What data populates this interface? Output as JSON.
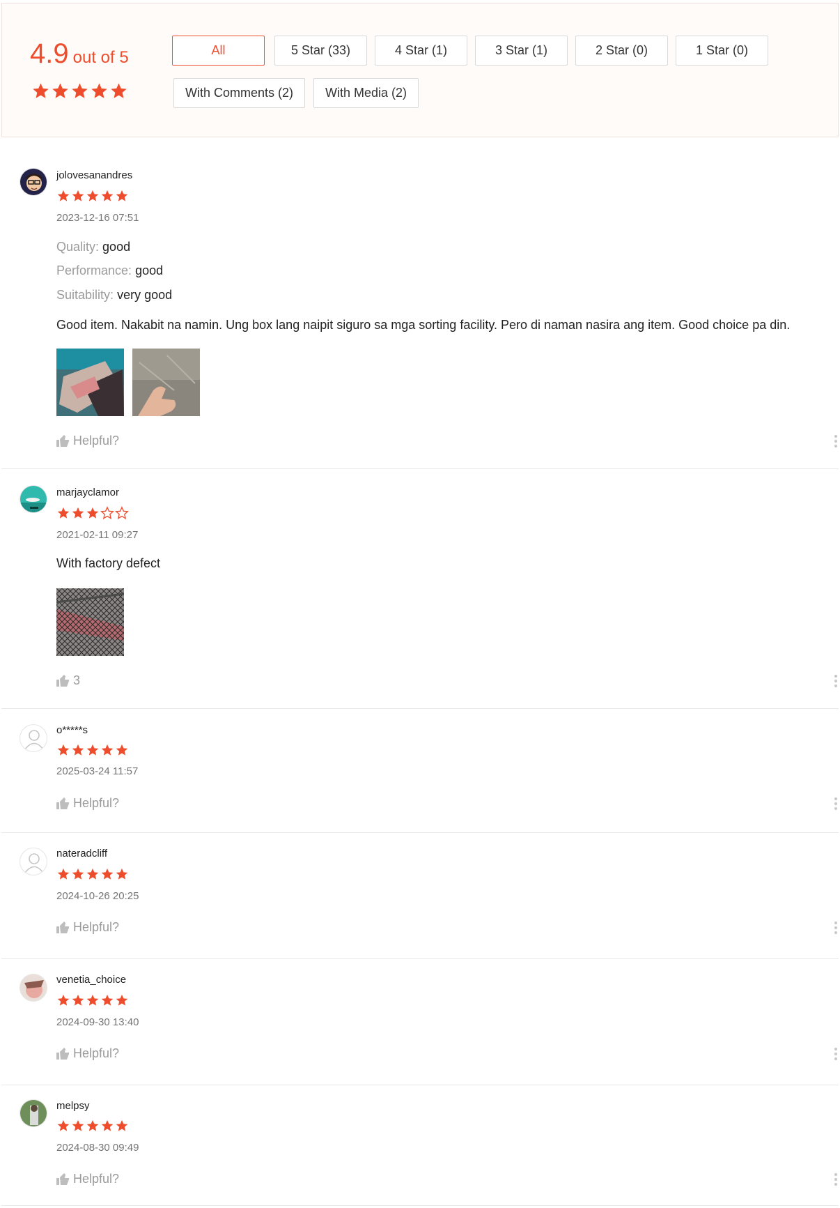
{
  "summary": {
    "score": "4.9",
    "out_of": "out of 5",
    "stars": 5,
    "filters": [
      {
        "label": "All",
        "active": true
      },
      {
        "label": "5 Star (33)"
      },
      {
        "label": "4 Star (1)"
      },
      {
        "label": "3 Star (1)"
      },
      {
        "label": "2 Star (0)"
      },
      {
        "label": "1 Star (0)"
      },
      {
        "label": "With Comments (2)"
      },
      {
        "label": "With Media (2)"
      }
    ]
  },
  "colors": {
    "accent": "#ee4d2d",
    "muted": "#9b9b9b",
    "text": "#222222"
  },
  "reviews": [
    {
      "author": "jolovesanandres",
      "rating": 5,
      "time": "2023-12-16 07:51",
      "attributes": [
        {
          "key": "Quality:",
          "value": "good"
        },
        {
          "key": "Performance:",
          "value": "good"
        },
        {
          "key": "Suitability:",
          "value": "very good"
        }
      ],
      "comment": "Good item. Nakabit na namin. Ung box lang naipit siguro sa mga sorting facility. Pero di naman nasira ang item. Good choice pa din.",
      "helpful": "Helpful?"
    },
    {
      "author": "marjayclamor",
      "rating": 3,
      "time": "2021-02-11 09:27",
      "comment": "With factory defect",
      "helpful": "3"
    },
    {
      "author": "o*****s",
      "rating": 5,
      "time": "2025-03-24 11:57",
      "helpful": "Helpful?"
    },
    {
      "author": "nateradcliff",
      "rating": 5,
      "time": "2024-10-26 20:25",
      "helpful": "Helpful?"
    },
    {
      "author": "venetia_choice",
      "rating": 5,
      "time": "2024-09-30 13:40",
      "helpful": "Helpful?"
    },
    {
      "author": "melpsy",
      "rating": 5,
      "time": "2024-08-30 09:49",
      "helpful": "Helpful?"
    }
  ]
}
